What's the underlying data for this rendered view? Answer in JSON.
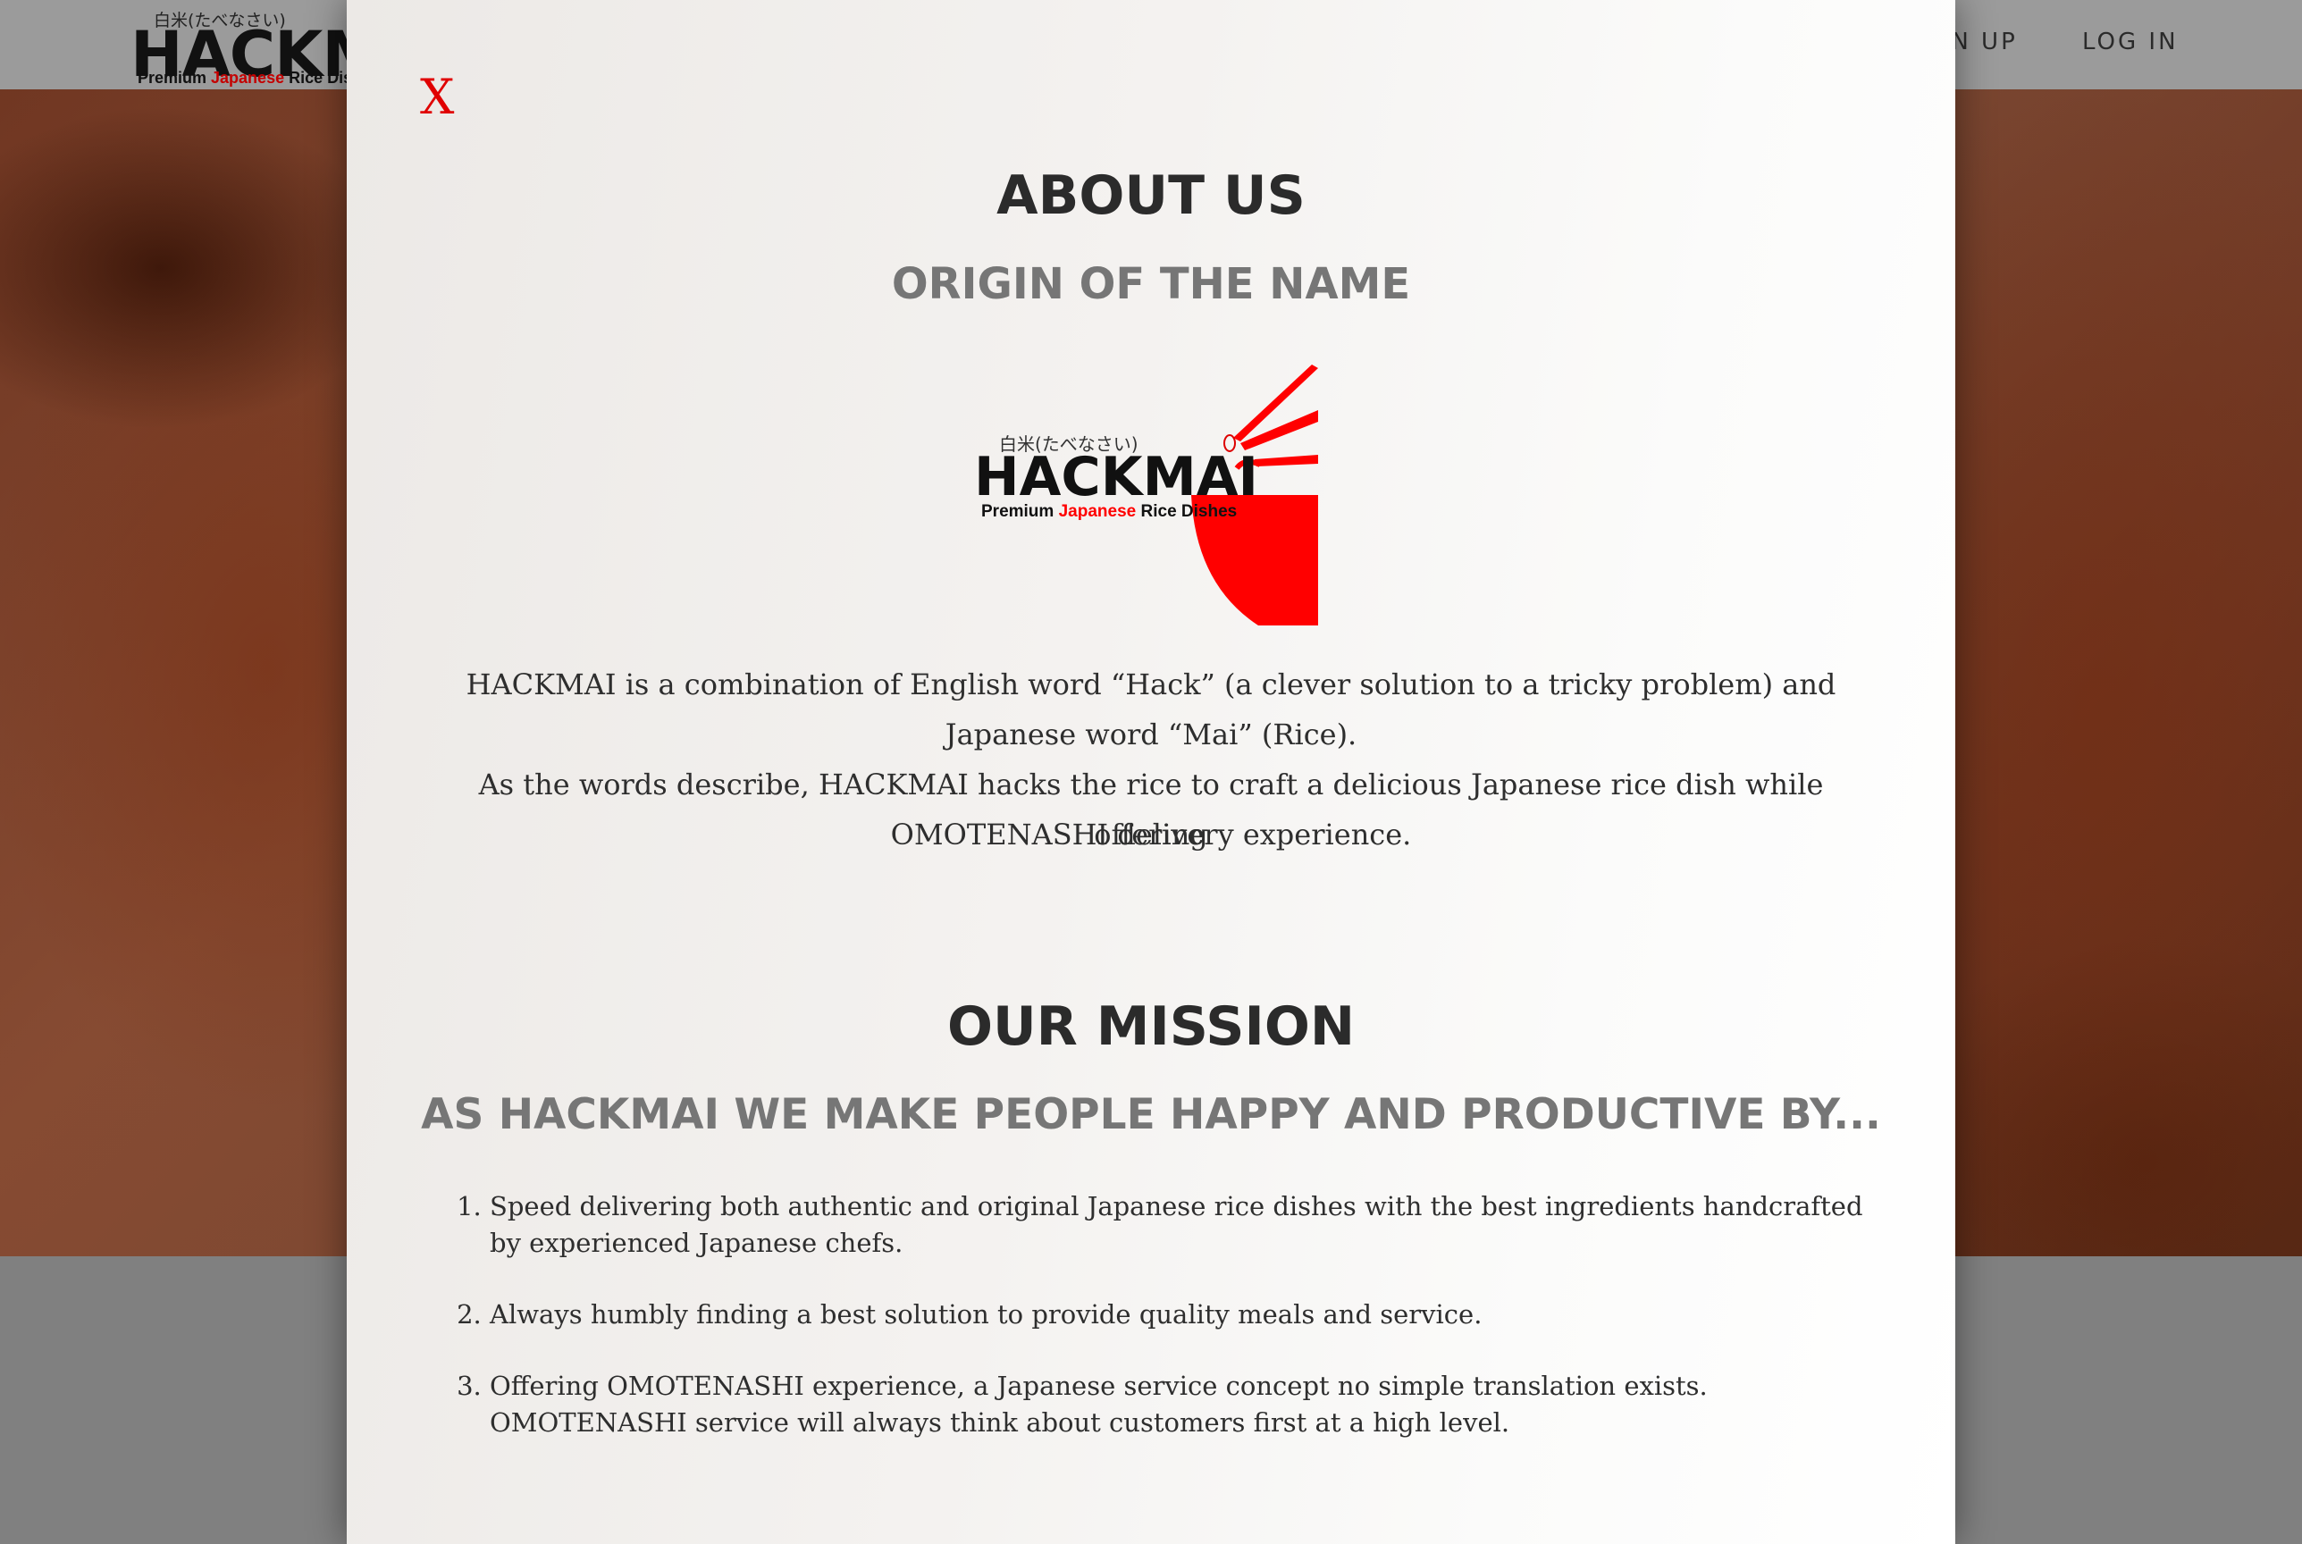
{
  "site": {
    "logo_kana": "白米(たべなさい)",
    "logo_word": "HACKMAI",
    "logo_tag_1": "Premium ",
    "logo_tag_red": "Japanese",
    "logo_tag_2": " Rice Dishes",
    "nav": {
      "signup": "SIGN UP",
      "login": "LOG IN"
    }
  },
  "modal": {
    "close_label": "X",
    "about_title": "ABOUT US",
    "origin_subtitle": "ORIGIN OF THE NAME",
    "logo": {
      "kana": "白米(たべなさい)",
      "word": "HACKMAI",
      "tag_1": "Premium ",
      "tag_red": "Japanese",
      "tag_2": " Rice Dishes",
      "accent_color": "#ff0000"
    },
    "origin_line_1": "HACKMAI is a combination of English word “Hack” (a clever solution to a tricky problem) and",
    "origin_line_2": "Japanese word “Mai” (Rice).",
    "origin_line_3": "As the words describe, HACKMAI hacks the rice to craft a delicious Japanese rice dish while offering",
    "origin_line_4": "OMOTENASHI delivery experience.",
    "mission_title": "OUR MISSION",
    "mission_subtitle": "AS HACKMAI WE MAKE PEOPLE HAPPY AND PRODUCTIVE BY...",
    "mission_items": [
      "Speed delivering both authentic and original Japanese rice dishes with the best ingredients handcrafted by experienced Japanese chefs.",
      "Always humbly finding a best solution to provide quality meals and service.",
      "Offering OMOTENASHI experience, a Japanese service concept no simple translation exists. OMOTENASHI service will always think about customers first at a high level."
    ]
  }
}
